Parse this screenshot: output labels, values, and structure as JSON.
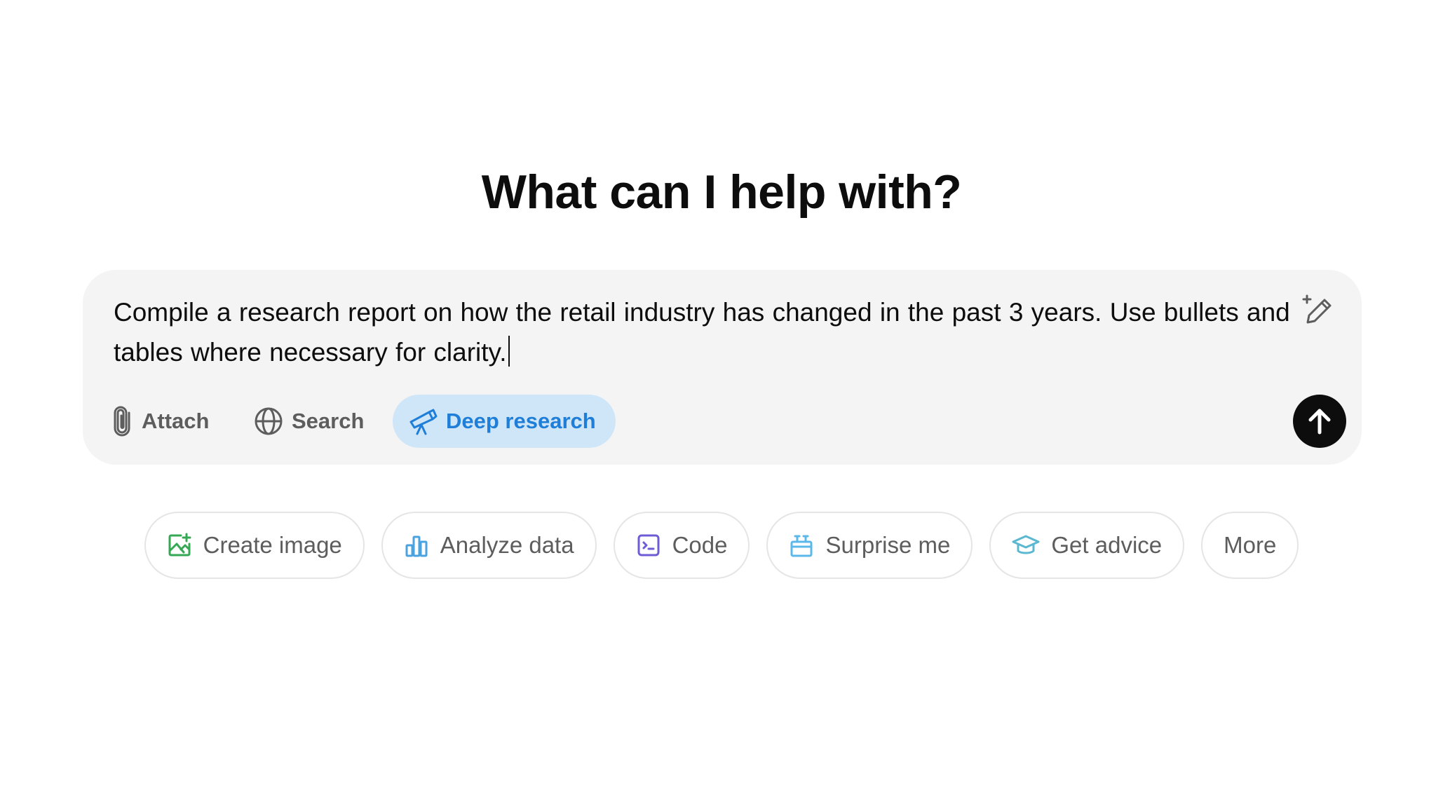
{
  "heading": "What can I help with?",
  "composer": {
    "input_value": "Compile a research report on how the retail industry has changed in the past 3 years. Use bullets and tables where necessary for clarity.",
    "tools": {
      "attach_label": "Attach",
      "search_label": "Search",
      "deep_research_label": "Deep research"
    },
    "deep_research_active": true,
    "accent_color": "#1f7ed8",
    "active_bg": "#cfe6f9"
  },
  "suggestions": [
    {
      "label": "Create image",
      "icon": "image-icon",
      "color": "#35a853"
    },
    {
      "label": "Analyze data",
      "icon": "bar-chart-icon",
      "color": "#4aa3df"
    },
    {
      "label": "Code",
      "icon": "code-icon",
      "color": "#6e5cd6"
    },
    {
      "label": "Surprise me",
      "icon": "gift-icon",
      "color": "#5bb8e8"
    },
    {
      "label": "Get advice",
      "icon": "graduation-cap-icon",
      "color": "#5bb8d0"
    },
    {
      "label": "More",
      "icon": "",
      "color": "#5d5d5d"
    }
  ]
}
